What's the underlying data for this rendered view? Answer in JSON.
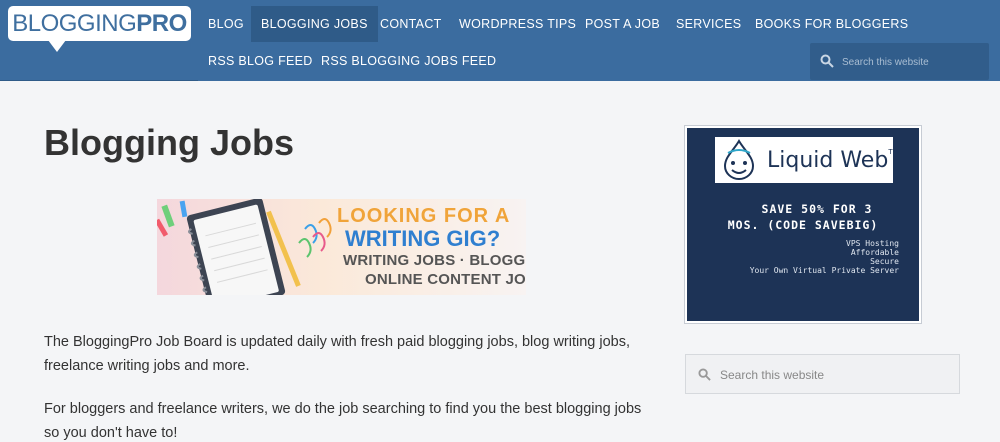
{
  "logo": {
    "part1": "BLOGGING",
    "part2": "PRO"
  },
  "nav": {
    "items": [
      {
        "label": "BLOG"
      },
      {
        "label": "BLOGGING JOBS"
      },
      {
        "label": "CONTACT"
      },
      {
        "label": "WORDPRESS TIPS"
      },
      {
        "label": "POST A JOB"
      },
      {
        "label": "SERVICES"
      },
      {
        "label": "BOOKS FOR BLOGGERS"
      },
      {
        "label": "RSS BLOG FEED"
      },
      {
        "label": "RSS BLOGGING JOBS FEED"
      }
    ],
    "search_placeholder": "Search this website"
  },
  "main": {
    "title": "Blogging Jobs",
    "banner": {
      "line1": "LOOKING FOR A",
      "line2": "WRITING GIG?",
      "line3": "WRITING JOBS · BLOGGER JOBS",
      "line4": "ONLINE CONTENT JOBS"
    },
    "paragraph1": "The BloggingPro Job Board is updated daily with fresh paid blogging jobs, blog writing jobs, freelance writing jobs and more.",
    "paragraph2": "For bloggers and freelance writers, we do the job searching to find you the best blogging jobs so you don't have to!"
  },
  "sidebar": {
    "ad": {
      "brand": "Liquid Web",
      "trademark": "TM",
      "offer_line1": "SAVE 50% FOR 3",
      "offer_line2": "MOS. (CODE SAVEBIG)",
      "features": [
        "VPS Hosting",
        "Affordable",
        "Secure",
        "Your Own Virtual Private Server"
      ]
    },
    "search_placeholder": "Search this website"
  },
  "colors": {
    "header": "#3b6c9f",
    "active_nav": "#2f5b88",
    "ad_background": "#1d3356",
    "page_background": "#f4f5f7"
  }
}
